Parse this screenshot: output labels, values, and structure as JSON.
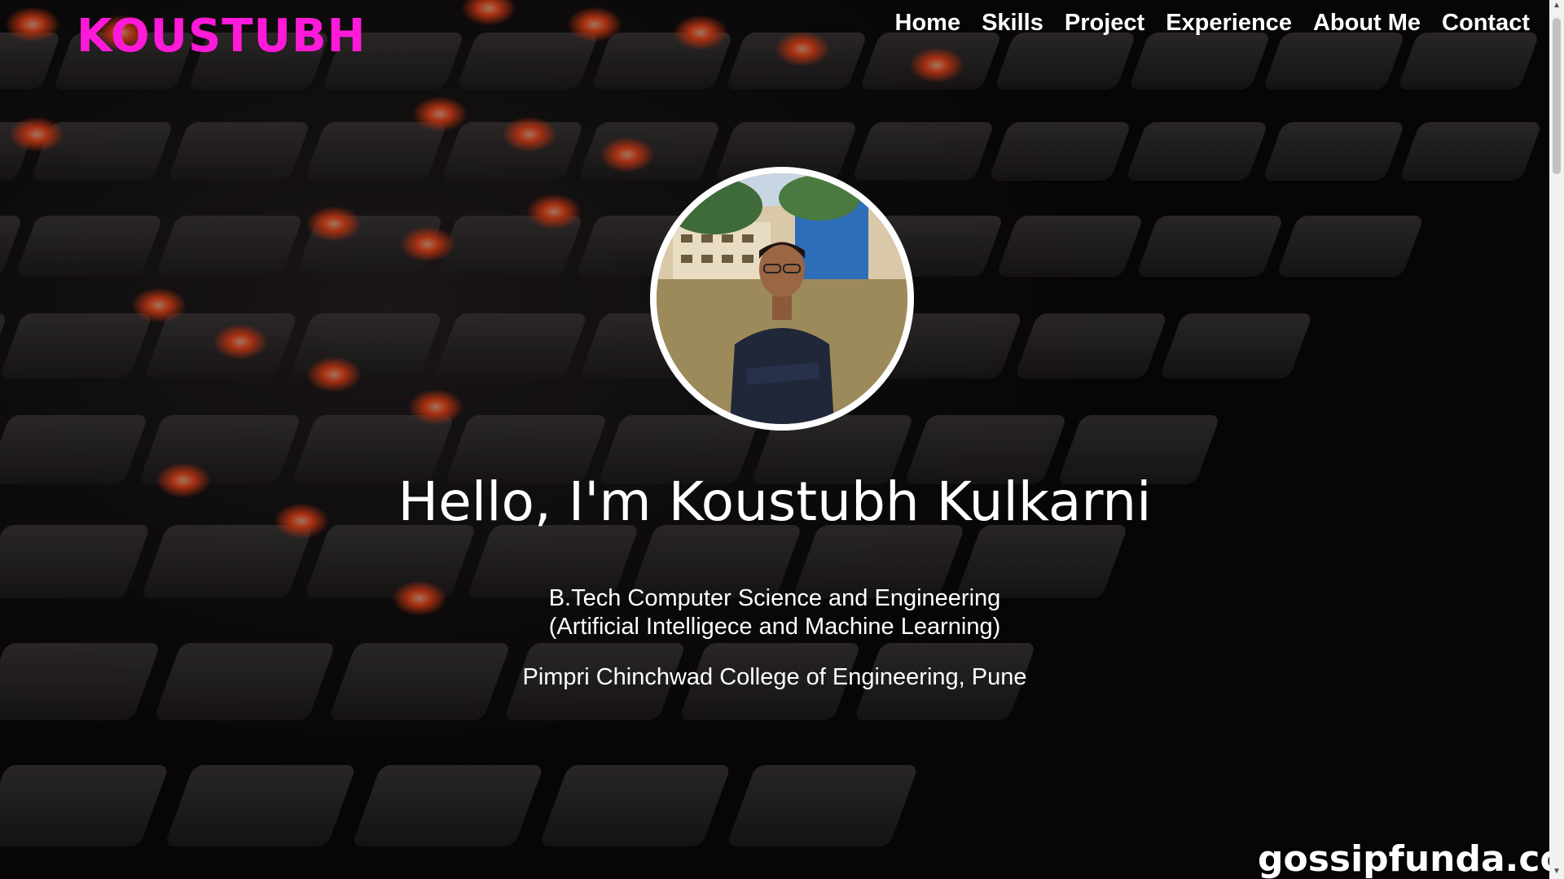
{
  "header": {
    "logo": "KOUSTUBH",
    "nav": [
      "Home",
      "Skills",
      "Project",
      "Experience",
      "About Me",
      "Contact"
    ]
  },
  "hero": {
    "headline": "Hello, I'm Koustubh Kulkarni",
    "degree_line1": "B.Tech Computer Science and Engineering",
    "degree_line2": "(Artificial Intelligece and Machine Learning)",
    "college": "Pimpri Chinchwad College of Engineering, Pune"
  },
  "watermark": "gossipfunda.com",
  "colors": {
    "logo": "#ff1ad9",
    "text": "#ffffff",
    "key_glow": "#ff4a1c"
  },
  "icons": {
    "scroll_up": "triangle-up",
    "scroll_down": "triangle-down"
  }
}
